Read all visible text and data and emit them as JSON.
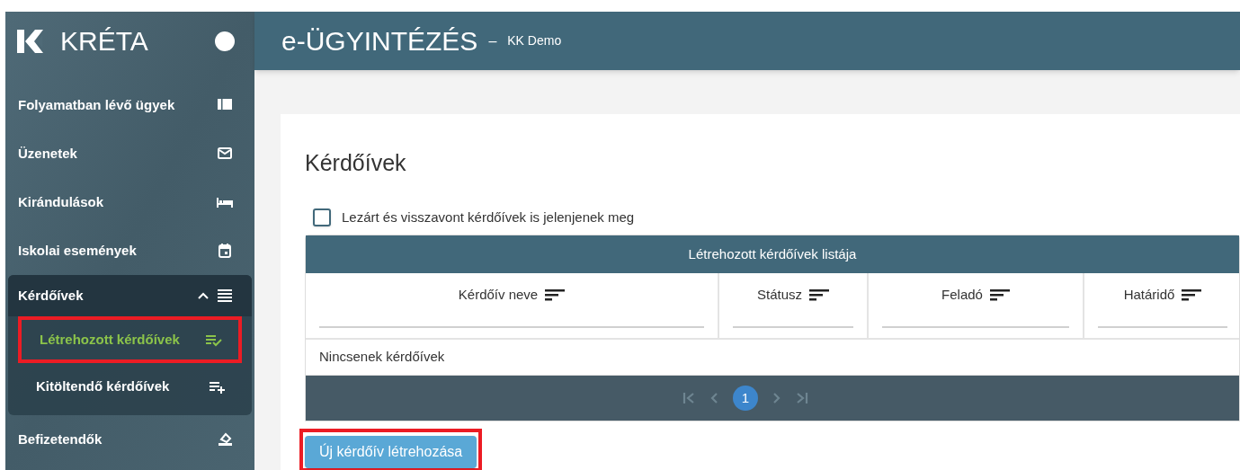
{
  "sidebar": {
    "logo": "KRÉTA",
    "items": [
      {
        "kind": "item",
        "label": "Folyamatban lévő ügyek"
      },
      {
        "kind": "item",
        "label": "Üzenetek"
      },
      {
        "kind": "item",
        "label": "Kirándulások"
      },
      {
        "kind": "item",
        "label": "Iskolai események"
      },
      {
        "kind": "group",
        "label": "Kérdőívek",
        "expanded": true,
        "children": [
          {
            "label": "Létrehozott kérdőívek",
            "selected": true,
            "highlighted": true
          },
          {
            "label": "Kitöltendő kérdőívek",
            "selected": false,
            "highlighted": false
          }
        ]
      },
      {
        "kind": "item",
        "label": "Befizetendők"
      }
    ]
  },
  "header": {
    "title": "e-ÜGYINTÉZÉS",
    "separator": "–",
    "subtitle": "KK Demo"
  },
  "page": {
    "heading": "Kérdőívek",
    "filter": {
      "label": "Lezárt és visszavont kérdőívek is jelenjenek meg",
      "checked": false
    },
    "table": {
      "title": "Létrehozott kérdőívek listája",
      "columns": [
        "Kérdőív neve",
        "Státusz",
        "Feladó",
        "Határidő"
      ],
      "empty_text": "Nincsenek kérdőívek",
      "pagination": {
        "pages": [
          {
            "label": "1",
            "selected": true
          }
        ]
      }
    },
    "button": {
      "label": "Új kérdőív létrehozása",
      "highlighted": true
    }
  }
}
